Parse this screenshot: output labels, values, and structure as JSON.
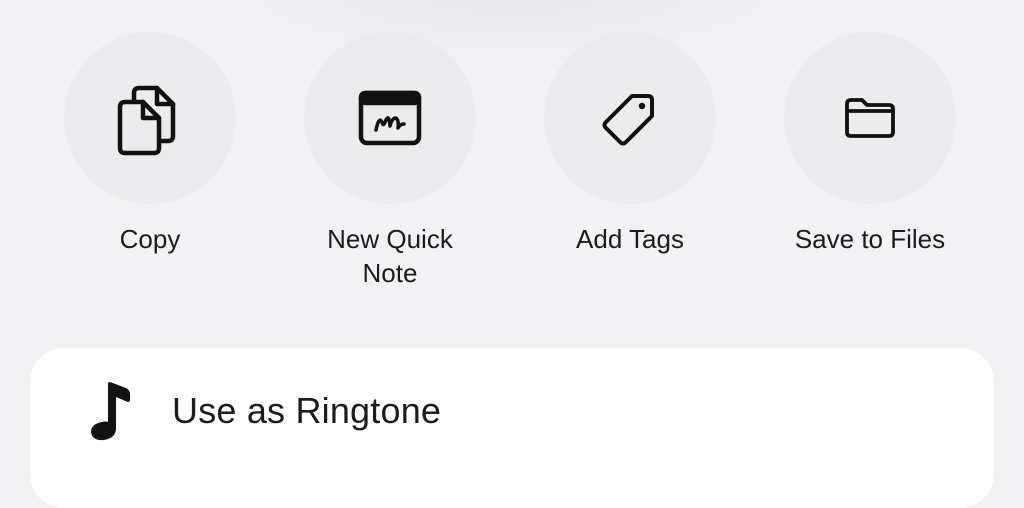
{
  "actions": [
    {
      "label": "Copy",
      "icon": "copy-icon"
    },
    {
      "label": "New Quick\nNote",
      "icon": "quick-note-icon"
    },
    {
      "label": "Add Tags",
      "icon": "tag-icon"
    },
    {
      "label": "Save to Files",
      "icon": "folder-icon"
    }
  ],
  "list": {
    "ringtone": {
      "label": "Use as Ringtone",
      "icon": "music-note-icon"
    }
  },
  "colors": {
    "background": "#f2f2f4",
    "circle": "#ececef",
    "card": "#ffffff",
    "text": "#1c1c1e"
  }
}
